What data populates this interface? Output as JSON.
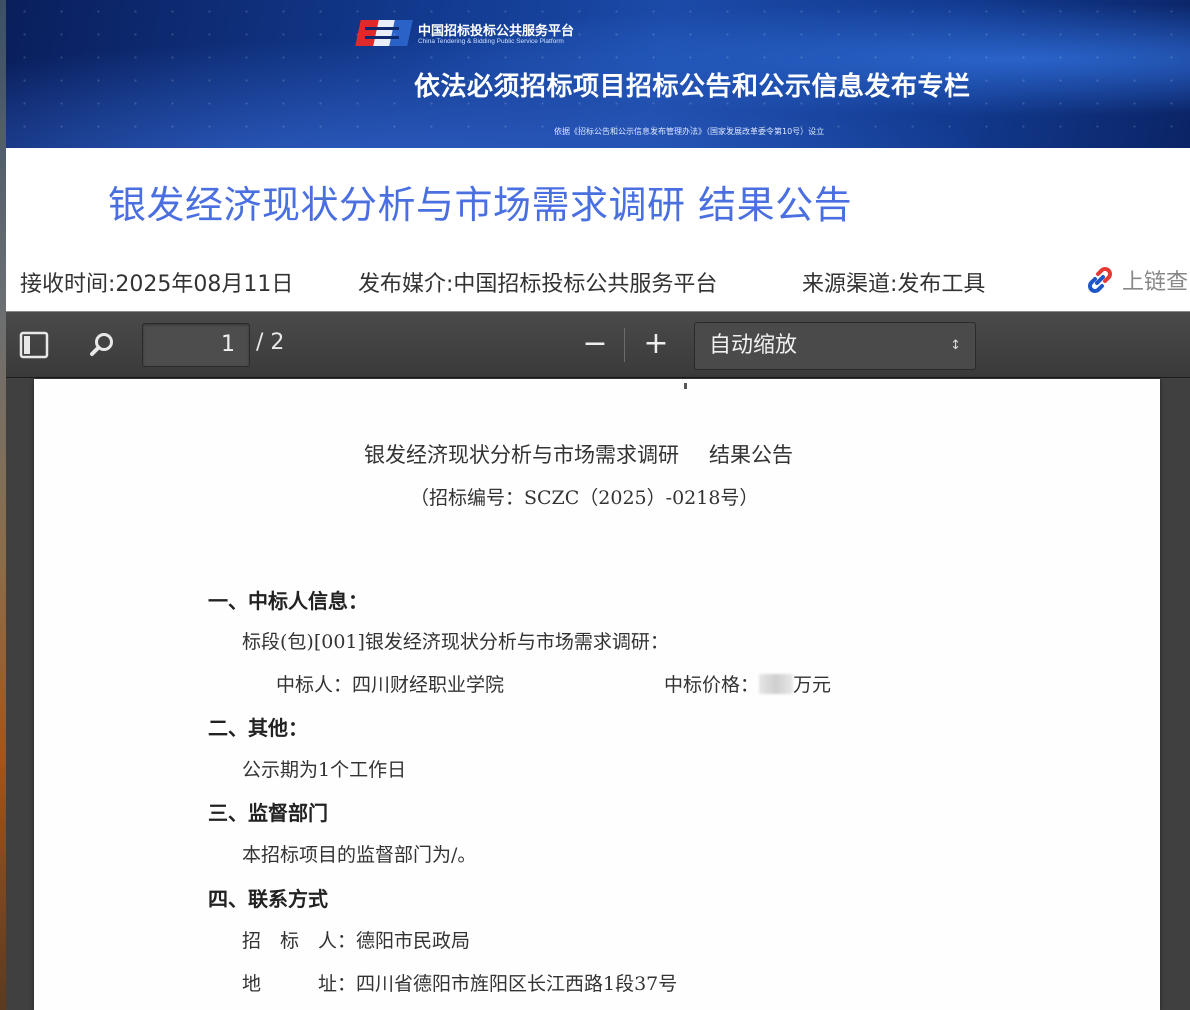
{
  "banner": {
    "platform_name": "中国招标投标公共服务平台",
    "platform_name_en": "China Tendering & Bidding Public Service Platform",
    "title": "依法必须招标项目招标公告和公示信息发布专栏",
    "subtitle": "依据《招标公告和公示信息发布管理办法》（国家发展改革委令第10号）设立"
  },
  "page": {
    "title": "银发经济现状分析与市场需求调研 结果公告",
    "received_time": "接收时间:2025年08月11日",
    "publish_media": "发布媒介:中国招标投标公共服务平台",
    "source_channel": "来源渠道:发布工具",
    "chain_label": "上链查"
  },
  "pdf_toolbar": {
    "current_page": "1",
    "total_pages": "/ 2",
    "zoom_out": "−",
    "zoom_in": "+",
    "zoom_value": "自动缩放"
  },
  "document": {
    "title_part1": "银发经济现状分析与市场需求调研",
    "title_part2": "结果公告",
    "number": "（招标编号：SCZC（2025）-0218号）",
    "section1": "一、中标人信息：",
    "lot_line": "标段(包)[001]银发经济现状分析与市场需求调研：",
    "winner": "中标人：四川财经职业学院",
    "price_label": "中标价格：",
    "price_suffix": "万元",
    "section2": "二、其他：",
    "other_text": "公示期为1个工作日",
    "section3": "三、监督部门",
    "supervision_text": "本招标项目的监督部门为/。",
    "section4": "四、联系方式",
    "tenderer": "招　标　人：德阳市民政局",
    "address": "地　　　址：四川省德阳市旌阳区长江西路1段37号"
  },
  "colors": {
    "page_title": "#4a6fe0",
    "banner_bg": "#123a8f",
    "toolbar_bg": "#3a3a3a"
  }
}
